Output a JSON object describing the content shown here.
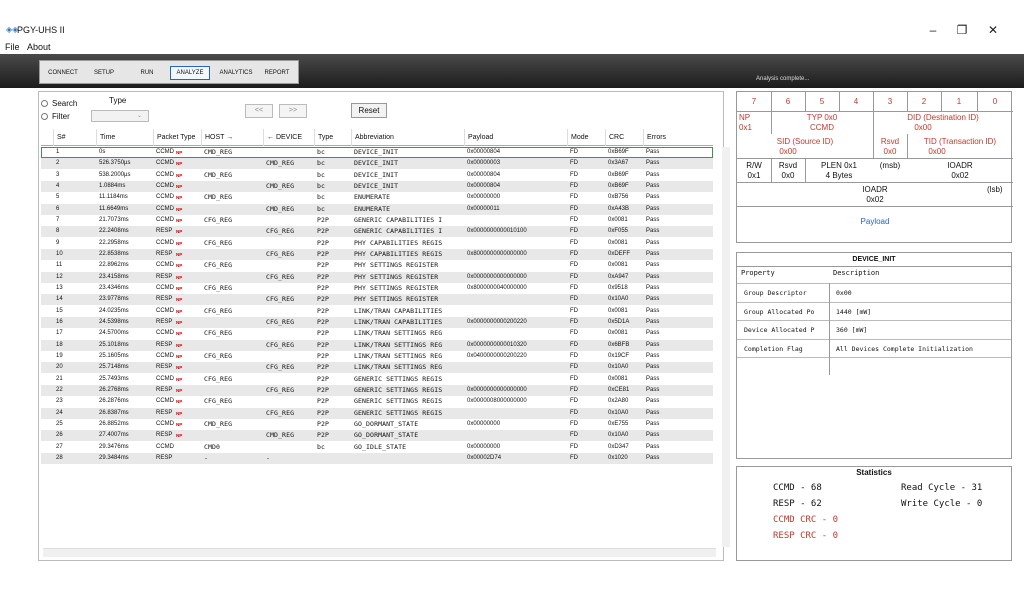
{
  "window": {
    "title": "PGY-UHS II",
    "icon": "app-logo-icon",
    "minimize": "–",
    "maximize": "❐",
    "close": "✕"
  },
  "menu": [
    "File",
    "About"
  ],
  "tabs": [
    {
      "label": "CONNECT",
      "selected": false
    },
    {
      "label": "SETUP",
      "selected": false
    },
    {
      "label": "RUN",
      "selected": false
    },
    {
      "label": "ANALYZE",
      "selected": true
    },
    {
      "label": "ANALYTICS",
      "selected": false
    },
    {
      "label": "REPORT",
      "selected": false
    }
  ],
  "status": "Analysis complete...",
  "search": {
    "label": "Search",
    "filter_label": "Filter",
    "type_label": "Type",
    "prev": "<<",
    "next": ">>",
    "reset": "Reset"
  },
  "columns": [
    "S#",
    "Time",
    "Packet Type",
    "HOST →",
    "← DEVICE",
    "Type",
    "Abbreviation",
    "Payload",
    "Mode",
    "CRC",
    "Errors"
  ],
  "rows": [
    [
      "1",
      "0s",
      "CCMD",
      true,
      "CMD_REG",
      "",
      "bc",
      "DEVICE_INIT",
      "0x00000804",
      "FD",
      "0xB69F",
      "Pass"
    ],
    [
      "2",
      "526.3750µs",
      "CCMD",
      true,
      "",
      "CMD_REG",
      "bc",
      "DEVICE_INIT",
      "0x00000003",
      "FD",
      "0x3A67",
      "Pass"
    ],
    [
      "3",
      "538.2000µs",
      "CCMD",
      true,
      "CMD_REG",
      "",
      "bc",
      "DEVICE_INIT",
      "0x00000804",
      "FD",
      "0xB69F",
      "Pass"
    ],
    [
      "4",
      "1.0884ms",
      "CCMD",
      true,
      "",
      "CMD_REG",
      "bc",
      "DEVICE_INIT",
      "0x00000804",
      "FD",
      "0xB69F",
      "Pass"
    ],
    [
      "5",
      "11.1184ms",
      "CCMD",
      true,
      "CMD_REG",
      "",
      "bc",
      "ENUMERATE",
      "0x00000000",
      "FD",
      "0xB756",
      "Pass"
    ],
    [
      "6",
      "11.6649ms",
      "CCMD",
      true,
      "",
      "CMD_REG",
      "bc",
      "ENUMERATE",
      "0x00000011",
      "FD",
      "0xA43B",
      "Pass"
    ],
    [
      "7",
      "21.7073ms",
      "CCMD",
      true,
      "CFG_REG",
      "",
      "P2P",
      "GENERIC CAPABILITIES I",
      "",
      "FD",
      "0x0081",
      "Pass"
    ],
    [
      "8",
      "22.2408ms",
      "RESP",
      true,
      "",
      "CFG_REG",
      "P2P",
      "GENERIC CAPABILITIES I",
      "0x0000000000010100",
      "FD",
      "0xF055",
      "Pass"
    ],
    [
      "9",
      "22.2958ms",
      "CCMD",
      true,
      "CFG_REG",
      "",
      "P2P",
      "PHY CAPABILITIES REGIS",
      "",
      "FD",
      "0x0081",
      "Pass"
    ],
    [
      "10",
      "22.8538ms",
      "RESP",
      true,
      "",
      "CFG_REG",
      "P2P",
      "PHY CAPABILITIES REGIS",
      "0x8000000000000000",
      "FD",
      "0xDEFF",
      "Pass"
    ],
    [
      "11",
      "22.8962ms",
      "CCMD",
      true,
      "CFG_REG",
      "",
      "P2P",
      "PHY SETTINGS REGISTER",
      "",
      "FD",
      "0x0081",
      "Pass"
    ],
    [
      "12",
      "23.4158ms",
      "RESP",
      true,
      "",
      "CFG_REG",
      "P2P",
      "PHY SETTINGS REGISTER",
      "0x0000000000000000",
      "FD",
      "0xA947",
      "Pass"
    ],
    [
      "13",
      "23.4346ms",
      "CCMD",
      true,
      "CFG_REG",
      "",
      "P2P",
      "PHY SETTINGS REGISTER",
      "0x8000000040000000",
      "FD",
      "0x9518",
      "Pass"
    ],
    [
      "14",
      "23.9778ms",
      "RESP",
      true,
      "",
      "CFG_REG",
      "P2P",
      "PHY SETTINGS REGISTER",
      "",
      "FD",
      "0x10A0",
      "Pass"
    ],
    [
      "15",
      "24.0235ms",
      "CCMD",
      true,
      "CFG_REG",
      "",
      "P2P",
      "LINK/TRAN CAPABILITIES",
      "",
      "FD",
      "0x0081",
      "Pass"
    ],
    [
      "16",
      "24.5398ms",
      "RESP",
      true,
      "",
      "CFG_REG",
      "P2P",
      "LINK/TRAN CAPABILITIES",
      "0x0000000000200220",
      "FD",
      "0x5D1A",
      "Pass"
    ],
    [
      "17",
      "24.5700ms",
      "CCMD",
      true,
      "CFG_REG",
      "",
      "P2P",
      "LINK/TRAN SETTINGS REG",
      "",
      "FD",
      "0x0081",
      "Pass"
    ],
    [
      "18",
      "25.1018ms",
      "RESP",
      true,
      "",
      "CFG_REG",
      "P2P",
      "LINK/TRAN SETTINGS REG",
      "0x0000000000010320",
      "FD",
      "0x6BFB",
      "Pass"
    ],
    [
      "19",
      "25.1605ms",
      "CCMD",
      true,
      "CFG_REG",
      "",
      "P2P",
      "LINK/TRAN SETTINGS REG",
      "0x0400000000200220",
      "FD",
      "0x19CF",
      "Pass"
    ],
    [
      "20",
      "25.7148ms",
      "RESP",
      true,
      "",
      "CFG_REG",
      "P2P",
      "LINK/TRAN SETTINGS REG",
      "",
      "FD",
      "0x10A0",
      "Pass"
    ],
    [
      "21",
      "25.7493ms",
      "CCMD",
      true,
      "CFG_REG",
      "",
      "P2P",
      "GENERIC SETTINGS REGIS",
      "",
      "FD",
      "0x0081",
      "Pass"
    ],
    [
      "22",
      "26.2768ms",
      "RESP",
      true,
      "",
      "CFG_REG",
      "P2P",
      "GENERIC SETTINGS REGIS",
      "0x0000000000000000",
      "FD",
      "0xCE81",
      "Pass"
    ],
    [
      "23",
      "26.2876ms",
      "CCMD",
      true,
      "CFG_REG",
      "",
      "P2P",
      "GENERIC SETTINGS REGIS",
      "0x0000008000000000",
      "FD",
      "0x2A80",
      "Pass"
    ],
    [
      "24",
      "26.8387ms",
      "RESP",
      true,
      "",
      "CFG_REG",
      "P2P",
      "GENERIC SETTINGS REGIS",
      "",
      "FD",
      "0x10A0",
      "Pass"
    ],
    [
      "25",
      "26.8852ms",
      "CCMD",
      true,
      "CMD_REG",
      "",
      "P2P",
      "GO_DORMANT_STATE",
      "0x00000000",
      "FD",
      "0xE755",
      "Pass"
    ],
    [
      "26",
      "27.4007ms",
      "RESP",
      true,
      "",
      "CMD_REG",
      "P2P",
      "GO_DORMANT_STATE",
      "",
      "FD",
      "0x10A0",
      "Pass"
    ],
    [
      "27",
      "29.3476ms",
      "CCMD",
      false,
      "CMD0",
      "",
      "bc",
      "GO_IDLE_STATE",
      "0x00000000",
      "FD",
      "0xD347",
      "Pass"
    ],
    [
      "28",
      "29.3484ms",
      "RESP",
      false,
      "-",
      "-",
      "",
      "",
      "0x00002D74",
      "FD",
      "0x1020",
      "Pass"
    ]
  ],
  "np_mark": "NP",
  "packet": {
    "bits": [
      "7",
      "6",
      "5",
      "4",
      "3",
      "2",
      "1",
      "0"
    ],
    "np": "NP",
    "np_val": "0x1",
    "typ": "TYP 0x0",
    "typ_val": "CCMD",
    "did": "DID (Destination ID)",
    "did_val": "0x00",
    "sid": "SID (Source ID)",
    "sid_val": "0x00",
    "rsvd": "Rsvd",
    "rsvd_val": "0x0",
    "tid": "TID (Transaction ID)",
    "tid_val": "0x00",
    "rw": "R/W",
    "rw_val": "0x1",
    "rsvd2": "Rsvd",
    "rsvd2_val": "0x0",
    "plen": "PLEN 0x1",
    "plen_val": "4 Bytes",
    "msb": "(msb)",
    "ioadr": "IOADR",
    "ioadr_val": "0x02",
    "ioadr2": "IOADR",
    "lsb": "(lsb)",
    "ioadr2_val": "0x02",
    "payload": "Payload"
  },
  "device": {
    "title": "DEVICE_INIT",
    "h_prop": "Property",
    "h_desc": "Description",
    "rows": [
      [
        "Group Descriptor",
        "0x00"
      ],
      [
        "Group Allocated Po",
        "1440 [mW]"
      ],
      [
        "Device Allocated P",
        "360 [mW]"
      ],
      [
        "Completion Flag",
        "All Devices Complete Initialization"
      ],
      [
        "",
        ""
      ]
    ]
  },
  "stats": {
    "title": "Statistics",
    "ccmd": "CCMD - 68",
    "resp": "RESP - 62",
    "ccmd_crc": "CCMD CRC - 0",
    "resp_crc": "RESP CRC - 0",
    "read": "Read Cycle - 31",
    "write": "Write Cycle - 0"
  },
  "colors": {
    "accent": "#2a63c7",
    "red": "#c0392b",
    "select": "#3a9a3a"
  }
}
